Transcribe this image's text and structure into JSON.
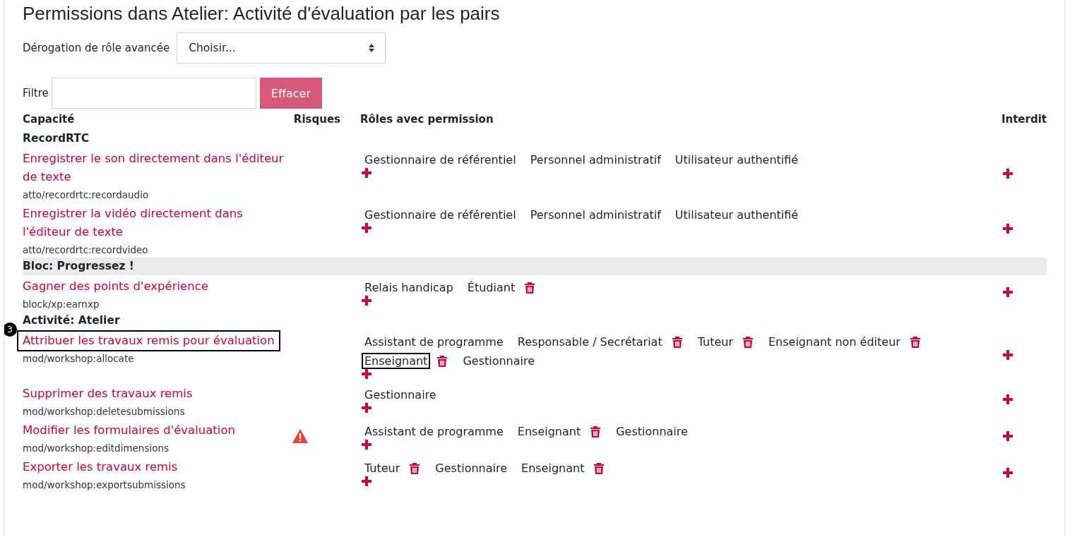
{
  "title": "Permissions dans Atelier: Activité d'évaluation par les pairs",
  "override": {
    "label": "Dérogation de rôle avancée",
    "value": "Choisir..."
  },
  "filter": {
    "label": "Filtre",
    "button": "Effacer"
  },
  "columns": [
    "Capacité",
    "Risques",
    "Rôles avec permission",
    "Interdit"
  ],
  "rows": [
    {
      "kind": "section",
      "title": "RecordRTC",
      "shaded": false
    },
    {
      "kind": "capability",
      "name": "Enregistrer le son directement dans l'éditeur de texte",
      "code": "atto/recordrtc:recordaudio",
      "risk": false,
      "highlighted": false,
      "roles": [
        {
          "name": "Gestionnaire de référentiel",
          "removable": false,
          "highlighted": false
        },
        {
          "name": "Personnel administratif",
          "removable": false,
          "highlighted": false
        },
        {
          "name": "Utilisateur authentifié",
          "removable": false,
          "highlighted": false
        }
      ]
    },
    {
      "kind": "capability",
      "name": "Enregistrer la vidéo directement dans l'éditeur de texte",
      "code": "atto/recordrtc:recordvideo",
      "risk": false,
      "highlighted": false,
      "roles": [
        {
          "name": "Gestionnaire de référentiel",
          "removable": false,
          "highlighted": false
        },
        {
          "name": "Personnel administratif",
          "removable": false,
          "highlighted": false
        },
        {
          "name": "Utilisateur authentifié",
          "removable": false,
          "highlighted": false
        }
      ]
    },
    {
      "kind": "section",
      "title": "Bloc: Progressez !",
      "shaded": true
    },
    {
      "kind": "capability",
      "name": "Gagner des points d'expérience",
      "code": "block/xp:earnxp",
      "risk": false,
      "highlighted": false,
      "roles": [
        {
          "name": "Relais handicap",
          "removable": false,
          "highlighted": false
        },
        {
          "name": "Étudiant",
          "removable": true,
          "highlighted": false
        }
      ]
    },
    {
      "kind": "section",
      "title": "Activité: Atelier",
      "shaded": false
    },
    {
      "kind": "capability",
      "name": "Attribuer les travaux remis pour évaluation",
      "code": "mod/workshop:allocate",
      "risk": false,
      "highlighted": true,
      "callout": "3",
      "roles": [
        {
          "name": "Assistant de programme",
          "removable": false,
          "highlighted": false
        },
        {
          "name": "Responsable / Secrétariat",
          "removable": true,
          "highlighted": false
        },
        {
          "name": "Tuteur",
          "removable": true,
          "highlighted": false
        },
        {
          "name": "Enseignant non éditeur",
          "removable": true,
          "highlighted": false
        },
        {
          "name": "Enseignant",
          "removable": true,
          "highlighted": true
        },
        {
          "name": "Gestionnaire",
          "removable": false,
          "highlighted": false
        }
      ]
    },
    {
      "kind": "capability",
      "name": "Supprimer des travaux remis",
      "code": "mod/workshop:deletesubmissions",
      "risk": false,
      "highlighted": false,
      "roles": [
        {
          "name": "Gestionnaire",
          "removable": false,
          "highlighted": false
        }
      ]
    },
    {
      "kind": "capability",
      "name": "Modifier les formulaires d'évaluation",
      "code": "mod/workshop:editdimensions",
      "risk": true,
      "highlighted": false,
      "roles": [
        {
          "name": "Assistant de programme",
          "removable": false,
          "highlighted": false
        },
        {
          "name": "Enseignant",
          "removable": true,
          "highlighted": false
        },
        {
          "name": "Gestionnaire",
          "removable": false,
          "highlighted": false
        }
      ]
    },
    {
      "kind": "capability",
      "name": "Exporter les travaux remis",
      "code": "mod/workshop:exportsubmissions",
      "risk": false,
      "highlighted": false,
      "roles": [
        {
          "name": "Tuteur",
          "removable": true,
          "highlighted": false
        },
        {
          "name": "Gestionnaire",
          "removable": false,
          "highlighted": false
        },
        {
          "name": "Enseignant",
          "removable": true,
          "highlighted": false
        }
      ]
    }
  ]
}
